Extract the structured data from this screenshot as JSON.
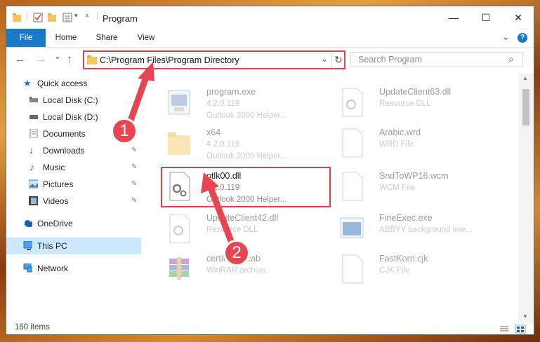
{
  "window": {
    "title": "Program",
    "controls": {
      "minimize": "—",
      "maximize": "☐",
      "close": "✕"
    }
  },
  "ribbon": {
    "tabs": [
      "File",
      "Home",
      "Share",
      "View"
    ],
    "expand": "⌄",
    "help": "?"
  },
  "nav": {
    "back": "←",
    "forward": "→",
    "recent": "⌄",
    "up": "↑"
  },
  "address": {
    "path": "C:\\Program Files\\Program Directory",
    "dropdown": "⌄",
    "refresh": "↻"
  },
  "search": {
    "placeholder": "Search Program",
    "icon": "⌕"
  },
  "sidebar": {
    "items": [
      {
        "label": "Quick access",
        "icon": "star-icon",
        "pinned": false
      },
      {
        "label": "Local Disk (C:)",
        "icon": "drive-icon",
        "pinned": false
      },
      {
        "label": "Local Disk (D:)",
        "icon": "drive-icon",
        "pinned": true
      },
      {
        "label": "Documents",
        "icon": "documents-icon",
        "pinned": true
      },
      {
        "label": "Downloads",
        "icon": "downloads-icon",
        "pinned": true
      },
      {
        "label": "Music",
        "icon": "music-icon",
        "pinned": true
      },
      {
        "label": "Pictures",
        "icon": "pictures-icon",
        "pinned": true
      },
      {
        "label": "Videos",
        "icon": "videos-icon",
        "pinned": true
      },
      {
        "label": "OneDrive",
        "icon": "onedrive-icon",
        "pinned": false
      },
      {
        "label": "This PC",
        "icon": "pc-icon",
        "pinned": false,
        "selected": true
      },
      {
        "label": "Network",
        "icon": "network-icon",
        "pinned": false
      }
    ],
    "pin_glyph": "📌"
  },
  "files": [
    {
      "name": "program.exe",
      "line2": "4.2.0.119",
      "line3": "Outlook 2000 Helper...",
      "icon": "exe-icon"
    },
    {
      "name": "UpdateClient63.dll",
      "line2": "Resource DLL",
      "line3": "",
      "icon": "dll-icon"
    },
    {
      "name": "x64",
      "line2": "4.2.0.119",
      "line3": "Outlook 2000 Helper...",
      "icon": "folder-icon"
    },
    {
      "name": "Arabic.wrd",
      "line2": "WRD File",
      "line3": "",
      "icon": "blank-file-icon"
    },
    {
      "name": "otlk00.dll",
      "line2": "4.2.0.119",
      "line3": "Outlook 2000 Helper...",
      "icon": "dll-gear-icon"
    },
    {
      "name": "SndToWP16.wcm",
      "line2": "WCM File",
      "line3": "",
      "icon": "blank-file-icon"
    },
    {
      "name": "UpdateClient42.dll",
      "line2": "Resource DLL",
      "line3": "",
      "icon": "dll-icon"
    },
    {
      "name": "FineExec.exe",
      "line2": "ABBYY background exe...",
      "line3": "",
      "icon": "exe-blue-icon"
    },
    {
      "name": "certificate.cab",
      "line2": "WinRAR archive",
      "line3": "",
      "icon": "winrar-icon"
    },
    {
      "name": "FastKorn.cjk",
      "line2": "CJK File",
      "line3": "",
      "icon": "blank-file-icon"
    }
  ],
  "status": {
    "count": "160 items"
  },
  "callouts": [
    "1",
    "2"
  ],
  "colors": {
    "accent": "#1979ca",
    "highlight": "#d9434e",
    "selected": "#cce8ff"
  }
}
